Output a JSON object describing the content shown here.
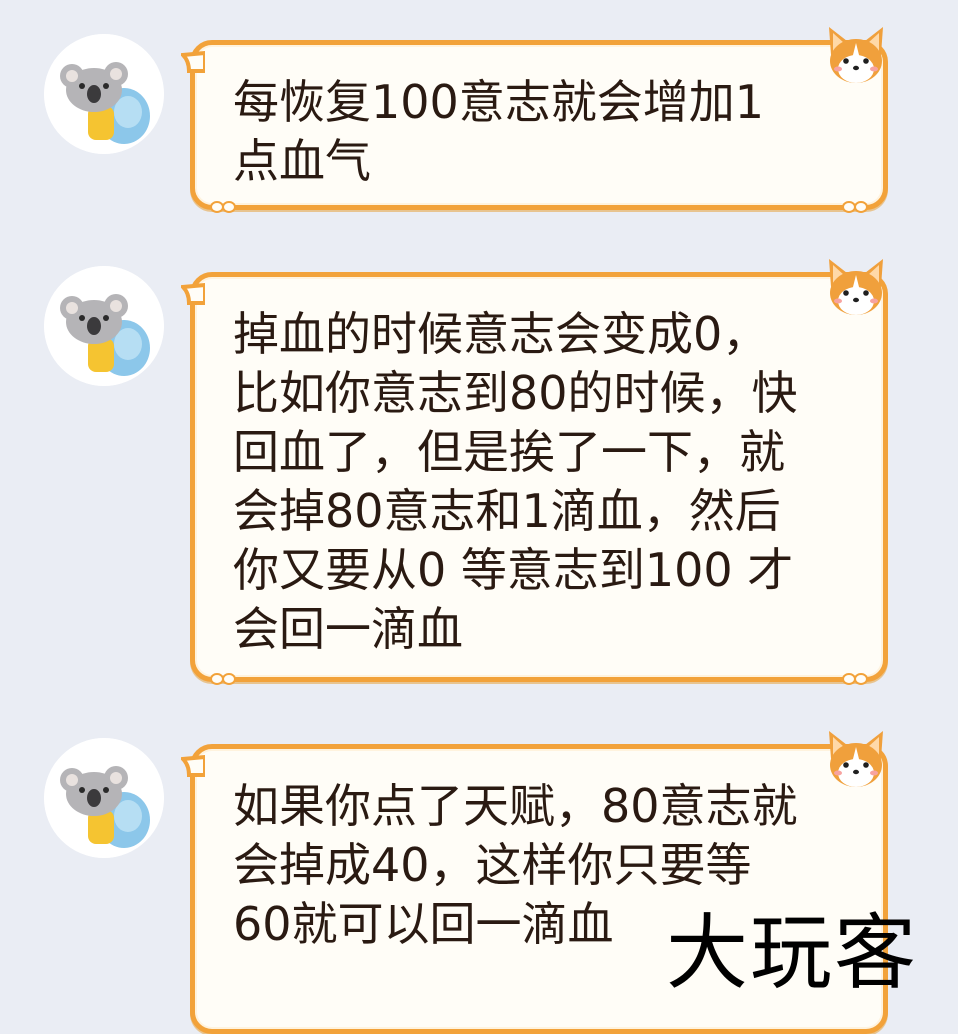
{
  "messages": [
    {
      "sender": "koala-avatar",
      "text": "每恢复100意志就会增加1\n点血气"
    },
    {
      "sender": "koala-avatar",
      "text": "掉血的时候意志会变成0，\n比如你意志到80的时候，快\n回血了，但是挨了一下，就\n会掉80意志和1滴血，然后\n你又要从0 等意志到100 才\n会回一滴血"
    },
    {
      "sender": "koala-avatar",
      "text": "如果你点了天赋，80意志就\n会掉成40，这样你只要等\n60就可以回一滴血"
    }
  ],
  "watermark": "大玩客",
  "colors": {
    "background": "#eaedf4",
    "bubble_fill": "#fffdf7",
    "bubble_border": "#f2a23a",
    "text": "#2a1a12",
    "corgi_orange": "#f0a03c"
  },
  "icons": {
    "avatar": "koala-with-blue-backpack-icon",
    "bubble_decoration": "corgi-head-icon"
  }
}
